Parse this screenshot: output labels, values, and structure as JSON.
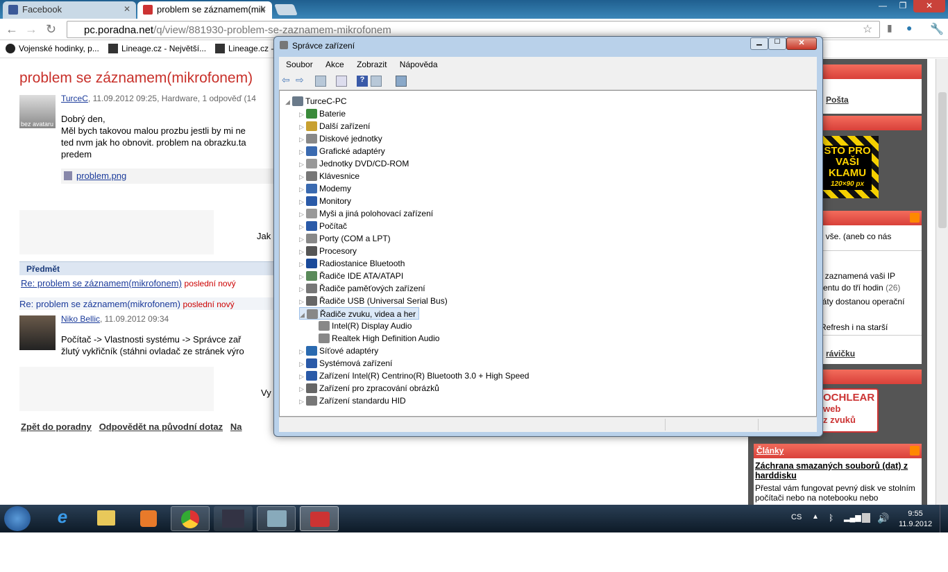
{
  "browser": {
    "tabs": [
      {
        "title": "Facebook",
        "color": "#3b5998"
      },
      {
        "title": "problem se záznamem(mik",
        "color": "#c33"
      }
    ],
    "url_host": "pc.poradna.net",
    "url_path": "/q/view/881930-problem-se-zaznamem-mikrofonem",
    "bookmarks": [
      "Vojenské hodinky, p...",
      "Lineage.cz - Největší...",
      "Lineage.cz -"
    ],
    "window_buttons": {
      "min": "—",
      "max": "❐",
      "close": "✕"
    }
  },
  "page": {
    "title": "problem se záznamem(mikrofonem)",
    "post": {
      "author": "TurceC",
      "meta": ", 11.09.2012 09:25, Hardware, 1 odpověď (14",
      "avatar_text": "bez avataru",
      "lines": [
        "Dobrý den,",
        "Měl bych takovou malou prozbu jestli by mi ne",
        "ted nvm jak ho obnovit. problem na obrazku.ta",
        "predem"
      ],
      "attachment": "problem.png"
    },
    "partial_text_1": "Jak",
    "subject_header": "Předmět",
    "reply_link": "Re: problem se záznamem(mikrofonem)",
    "reply_tag": "poslední nový",
    "reply_link2": "Re: problem se záznamem(mikrofonem)",
    "reply_tag2": "poslední nový",
    "reply": {
      "author": "Niko Bellic",
      "meta": ", 11.09.2012 09:34",
      "lines": [
        "Počítač -> Vlastnosti systému -> Správce zař",
        "žlutý vykřičník (stáhni ovladač ze stránek výro"
      ]
    },
    "partial_text_2": "Vy",
    "bottom_links": [
      "Zpět do poradny",
      "Odpovědět na původní dotaz",
      "Na"
    ]
  },
  "sidebar": {
    "mail_link": "Pošta",
    "ad_lines": [
      "STO PRO",
      "VAŠI",
      "KLAMU",
      "120×90 px"
    ],
    "news_1": "\" vše. (aneb co nás",
    "news_2": "t zaznamená vaši IP",
    "news_3": "rentu do tří hodin",
    "news_3_count": "(26)",
    "news_4": "láty dostanou operační",
    "news_5": "Refresh i na starší",
    "news_link": "rávičku",
    "ad2_lines": [
      "OCHLEAR",
      "web",
      "z zvuků"
    ],
    "articles_header": "Články",
    "article_title": "Záchrana smazaných souborů (dat) z harddisku",
    "article_text": "Přestal vám fungovat pevný disk ve stolním počítači nebo na notebooku nebo"
  },
  "dialog": {
    "title": "Správce zařízení",
    "menu": [
      "Soubor",
      "Akce",
      "Zobrazit",
      "Nápověda"
    ],
    "root": "TurceC-PC",
    "items": [
      {
        "label": "Baterie",
        "icon": "battery-icon",
        "color": "#3a8a3a"
      },
      {
        "label": "Další zařízení",
        "icon": "unknown-device-icon",
        "color": "#c8a030"
      },
      {
        "label": "Diskové jednotky",
        "icon": "disk-icon",
        "color": "#888"
      },
      {
        "label": "Grafické adaptéry",
        "icon": "display-adapter-icon",
        "color": "#3a6ab0"
      },
      {
        "label": "Jednotky DVD/CD-ROM",
        "icon": "dvd-icon",
        "color": "#999"
      },
      {
        "label": "Klávesnice",
        "icon": "keyboard-icon",
        "color": "#777"
      },
      {
        "label": "Modemy",
        "icon": "modem-icon",
        "color": "#3a6ab0"
      },
      {
        "label": "Monitory",
        "icon": "monitor-icon",
        "color": "#2a5aa8"
      },
      {
        "label": "Myši a jiná polohovací zařízení",
        "icon": "mouse-icon",
        "color": "#999"
      },
      {
        "label": "Počítač",
        "icon": "computer-icon",
        "color": "#2a5aa8"
      },
      {
        "label": "Porty (COM a LPT)",
        "icon": "port-icon",
        "color": "#888"
      },
      {
        "label": "Procesory",
        "icon": "processor-icon",
        "color": "#555"
      },
      {
        "label": "Radiostanice Bluetooth",
        "icon": "bluetooth-icon",
        "color": "#1a4a9a"
      },
      {
        "label": "Řadiče IDE ATA/ATAPI",
        "icon": "ide-controller-icon",
        "color": "#5a8a5a"
      },
      {
        "label": "Řadiče paměťových zařízení",
        "icon": "storage-controller-icon",
        "color": "#777"
      },
      {
        "label": "Řadiče USB (Universal Serial Bus)",
        "icon": "usb-icon",
        "color": "#666"
      }
    ],
    "sound_node": {
      "label": "Řadiče zvuku, videa a her",
      "icon": "sound-icon",
      "color": "#777"
    },
    "sound_children": [
      "Intel(R) Display Audio",
      "Realtek High Definition Audio"
    ],
    "items_after": [
      {
        "label": "Síťové adaptéry",
        "icon": "network-adapter-icon",
        "color": "#2a6ab0"
      },
      {
        "label": "Systémová zařízení",
        "icon": "system-device-icon",
        "color": "#2a5aa8"
      },
      {
        "label": "Zařízení Intel(R) Centrino(R) Bluetooth 3.0 + High Speed",
        "icon": "bluetooth-device-icon",
        "color": "#2a5aa8"
      },
      {
        "label": "Zařízení pro zpracování obrázků",
        "icon": "imaging-device-icon",
        "color": "#666"
      },
      {
        "label": "Zařízení standardu HID",
        "icon": "hid-icon",
        "color": "#777"
      }
    ]
  },
  "taskbar": {
    "lang": "CS",
    "time": "9:55",
    "date": "11.9.2012"
  }
}
